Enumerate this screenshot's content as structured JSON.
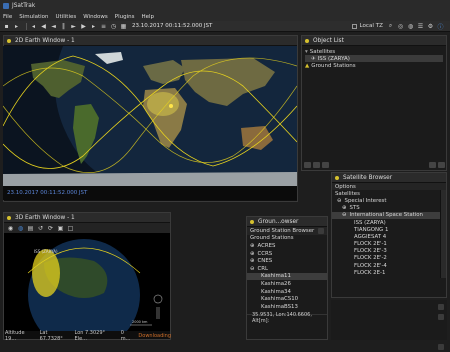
{
  "app": {
    "title": "JSatTrak"
  },
  "menu": [
    "File",
    "Simulation",
    "Utilities",
    "Windows",
    "Plugins",
    "Help"
  ],
  "toolbar": {
    "time": "23.10.2017 00:11:52.000 JST",
    "tz_label": "Local TZ"
  },
  "win2d": {
    "title": "2D Earth Window - 1",
    "status_time": "23.10.2017 00:11:52.000 JST"
  },
  "objectlist": {
    "title": "Object List",
    "items": [
      {
        "label": "Satellites"
      },
      {
        "label": "ISS (ZARYA)"
      },
      {
        "label": "Ground Stations"
      }
    ]
  },
  "win3d": {
    "title": "3D Earth Window - 1",
    "status": {
      "altitude": "Altitude 19...",
      "lat": "Lat 67.7328°",
      "lon": "Lon 7.3029° Ele...",
      "dl": "0 m...",
      "downloading": "Downloading"
    },
    "scale": "2000 km"
  },
  "gsb": {
    "title": "Groun...owser",
    "browser_label": "Ground Station Browser",
    "header": "Ground Stations",
    "items": [
      "ACRES",
      "CCRS",
      "CNES",
      "CRL",
      "Kashima11",
      "Kashima26",
      "Kashima34",
      "KashimaCS10",
      "KashimaBS13"
    ],
    "coords": "35.9531, Lon:140.6606, Alt[m]:"
  },
  "satbrowser": {
    "title": "Satellite Browser",
    "options": "Options",
    "items": [
      "Satellites",
      "Special Interest",
      "STS",
      "International Space Station",
      "ISS (ZARYA)",
      "TIANGONG 1",
      "AGGIESAT 4",
      "FLOCK 2E'-1",
      "FLOCK 2E'-3",
      "FLOCK 2E'-2",
      "FLOCK 2E'-4",
      "FLOCK 2E-1"
    ]
  },
  "colors": {
    "orbit": "#e6d21e",
    "night": "#0a1624",
    "accent": "#3a6db3",
    "status_text": "#5c86d8"
  }
}
